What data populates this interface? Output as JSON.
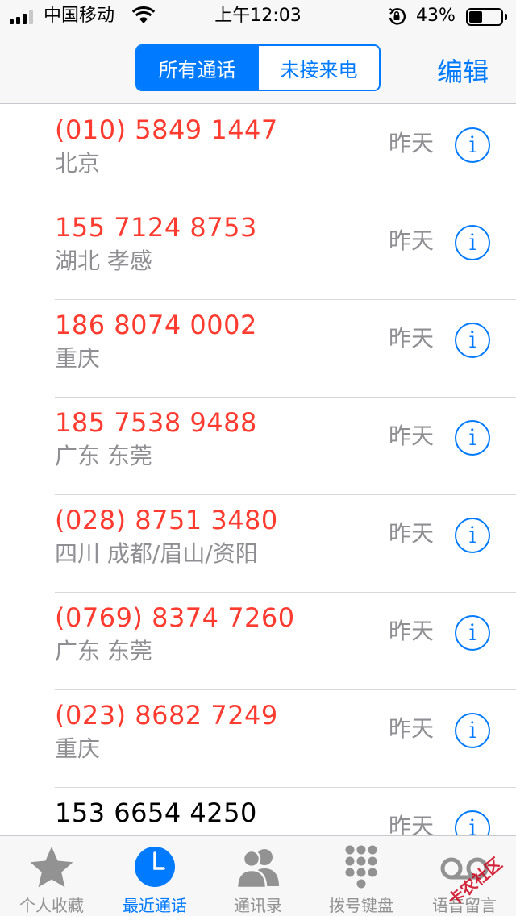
{
  "status": {
    "carrier": "中国移动",
    "time": "上午12:03",
    "battery_percent": "43%",
    "battery_level": 0.43,
    "signal_bars": 4,
    "signal_bars_active": 3
  },
  "nav": {
    "segments": [
      "所有通话",
      "未接来电"
    ],
    "active_segment": 0,
    "edit_label": "编辑"
  },
  "calls": [
    {
      "number": "(010) 5849 1447",
      "location": "北京",
      "date": "昨天",
      "missed": true
    },
    {
      "number": "155 7124 8753",
      "location": "湖北 孝感",
      "date": "昨天",
      "missed": true
    },
    {
      "number": "186 8074 0002",
      "location": "重庆",
      "date": "昨天",
      "missed": true
    },
    {
      "number": "185 7538 9488",
      "location": "广东 东莞",
      "date": "昨天",
      "missed": true
    },
    {
      "number": "(028) 8751 3480",
      "location": "四川 成都/眉山/资阳",
      "date": "昨天",
      "missed": true
    },
    {
      "number": "(0769) 8374 7260",
      "location": "广东 东莞",
      "date": "昨天",
      "missed": true
    },
    {
      "number": "(023) 8682 7249",
      "location": "重庆",
      "date": "昨天",
      "missed": true
    },
    {
      "number": "153 6654 4250",
      "location": "",
      "date": "昨天",
      "missed": false
    }
  ],
  "info_glyph": "i",
  "tabs": [
    {
      "label": "个人收藏",
      "icon": "star-icon"
    },
    {
      "label": "最近通话",
      "icon": "clock-icon"
    },
    {
      "label": "通讯录",
      "icon": "contacts-icon"
    },
    {
      "label": "拨号键盘",
      "icon": "keypad-icon"
    },
    {
      "label": "语音留言",
      "icon": "voicemail-icon"
    }
  ],
  "active_tab": 1,
  "watermark": "卡农社区",
  "colors": {
    "accent": "#007aff",
    "missed": "#ff3b30",
    "secondary": "#8e8e93"
  }
}
